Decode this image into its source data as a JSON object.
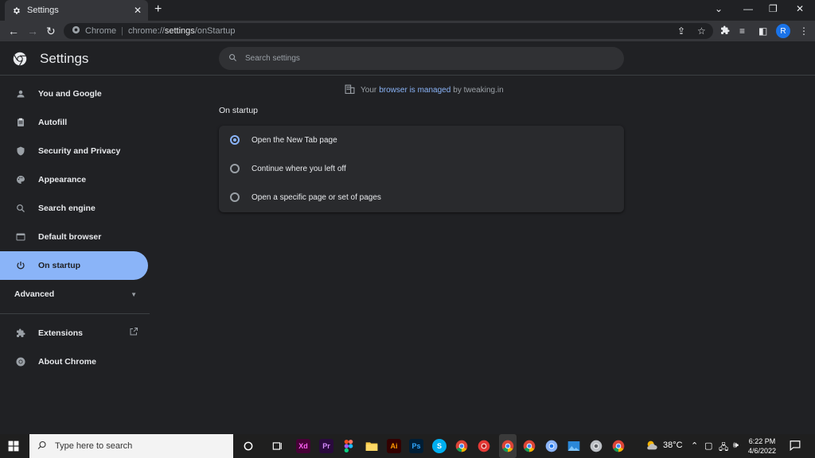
{
  "browser": {
    "tab_title": "Settings",
    "omnibox_origin": "Chrome",
    "omnibox_url_prefix": "chrome://",
    "omnibox_url_host": "settings",
    "omnibox_url_path": "/onStartup",
    "avatar_letter": "R"
  },
  "header": {
    "title": "Settings",
    "search_placeholder": "Search settings"
  },
  "sidebar": {
    "items": [
      {
        "label": "You and Google",
        "icon": "person-icon"
      },
      {
        "label": "Autofill",
        "icon": "clipboard-icon"
      },
      {
        "label": "Security and Privacy",
        "icon": "shield-icon"
      },
      {
        "label": "Appearance",
        "icon": "palette-icon"
      },
      {
        "label": "Search engine",
        "icon": "search-icon"
      },
      {
        "label": "Default browser",
        "icon": "browser-icon"
      },
      {
        "label": "On startup",
        "icon": "power-icon",
        "active": true
      }
    ],
    "advanced_label": "Advanced",
    "extensions_label": "Extensions",
    "about_label": "About Chrome"
  },
  "main": {
    "managed_prefix": "Your",
    "managed_link": "browser is managed",
    "managed_suffix": "by tweaking.in",
    "section_title": "On startup",
    "options": [
      {
        "label": "Open the New Tab page",
        "checked": true
      },
      {
        "label": "Continue where you left off",
        "checked": false
      },
      {
        "label": "Open a specific page or set of pages",
        "checked": false
      }
    ]
  },
  "taskbar": {
    "search_placeholder": "Type here to search",
    "apps": [
      {
        "name": "xd-icon",
        "text": "Xd",
        "bg": "#470137",
        "fg": "#ff61f6"
      },
      {
        "name": "premiere-icon",
        "text": "Pr",
        "bg": "#2a0a3d",
        "fg": "#d68cff"
      },
      {
        "name": "illustrator-icon",
        "text": "Ai",
        "bg": "#330000",
        "fg": "#ff9a00"
      },
      {
        "name": "photoshop-icon",
        "text": "Ps",
        "bg": "#001e36",
        "fg": "#31a8ff"
      },
      {
        "name": "skype-icon",
        "text": "S",
        "bg": "#00aff0",
        "fg": "#ffffff"
      }
    ],
    "temperature": "38°C",
    "time": "6:22 PM",
    "date": "4/6/2022"
  },
  "colors": {
    "accent": "#8ab4f8",
    "background": "#202124",
    "card": "#292a2d"
  }
}
